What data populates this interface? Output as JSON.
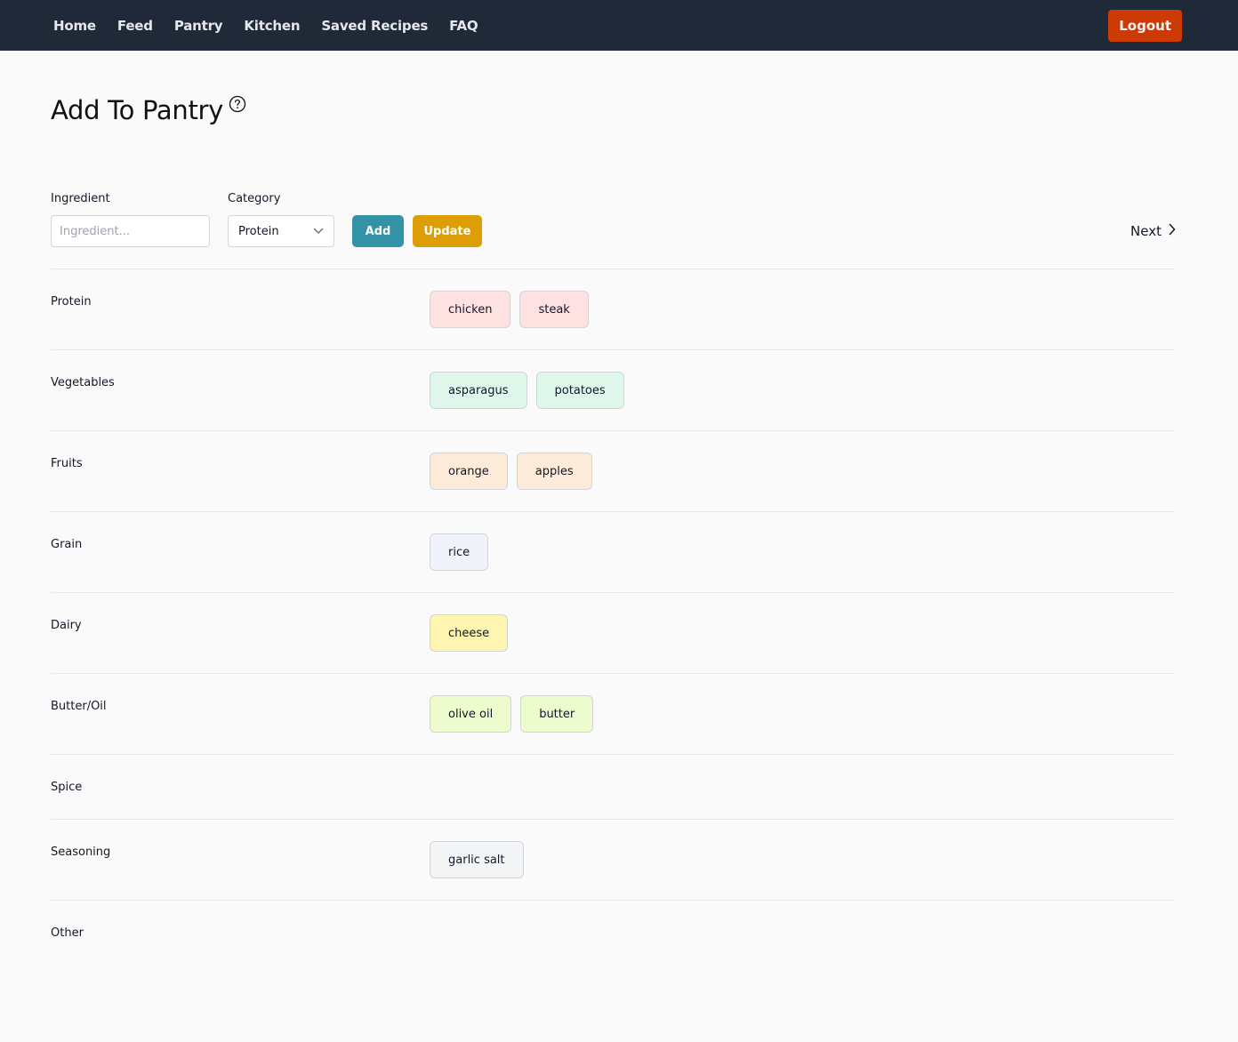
{
  "nav": {
    "links": [
      "Home",
      "Feed",
      "Pantry",
      "Kitchen",
      "Saved Recipes",
      "FAQ"
    ],
    "logout_label": "Logout"
  },
  "page": {
    "title": "Add To Pantry",
    "help_icon": "question-circle-icon"
  },
  "form": {
    "ingredient_label": "Ingredient",
    "ingredient_placeholder": "Ingredient...",
    "ingredient_value": "",
    "category_label": "Category",
    "category_selected": "Protein",
    "add_label": "Add",
    "update_label": "Update",
    "next_label": "Next"
  },
  "colors": {
    "nav_bg": "#1f2937",
    "logout": "#cc3b06",
    "add": "#3293a6",
    "update": "#dd9d05"
  },
  "categories": [
    {
      "name": "Protein",
      "color": "#fee2e2",
      "items": [
        "chicken",
        "steak"
      ]
    },
    {
      "name": "Vegetables",
      "color": "#dff7ea",
      "items": [
        "asparagus",
        "potatoes"
      ]
    },
    {
      "name": "Fruits",
      "color": "#fdebda",
      "items": [
        "orange",
        "apples"
      ]
    },
    {
      "name": "Grain",
      "color": "#f0f3f9",
      "items": [
        "rice"
      ]
    },
    {
      "name": "Dairy",
      "color": "#fdf5b0",
      "items": [
        "cheese"
      ]
    },
    {
      "name": "Butter/Oil",
      "color": "#eefbcd",
      "items": [
        "olive oil",
        "butter"
      ]
    },
    {
      "name": "Spice",
      "color": "#f3f4f6",
      "items": []
    },
    {
      "name": "Seasoning",
      "color": "#f3f4f6",
      "items": [
        "garlic salt"
      ]
    },
    {
      "name": "Other",
      "color": "#f3f4f6",
      "items": []
    }
  ]
}
